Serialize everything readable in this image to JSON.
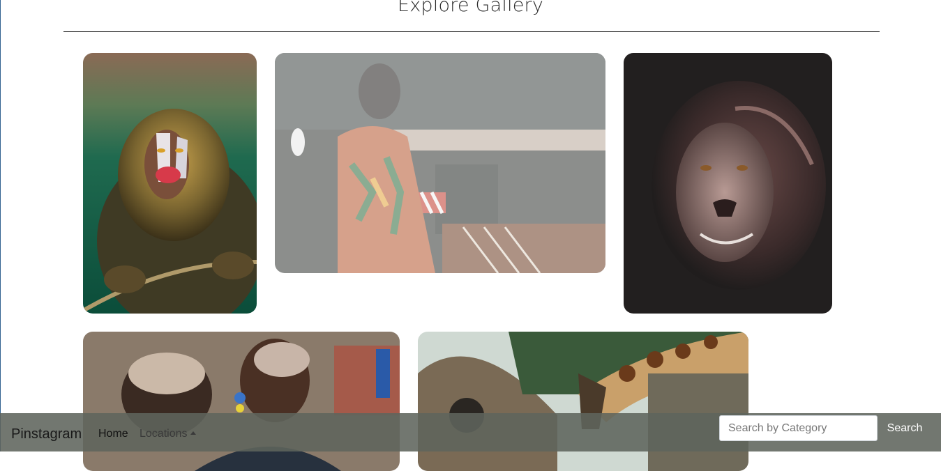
{
  "page": {
    "title": "Explore Gallery"
  },
  "gallery": {
    "images": [
      {
        "subject": "mandrill baboon holding rope"
      },
      {
        "subject": "musician playing marimba"
      },
      {
        "subject": "lion portrait"
      },
      {
        "subject": "two maasai women"
      },
      {
        "subject": "giraffe near huts"
      }
    ]
  },
  "navbar": {
    "brand": "Pinstagram",
    "links": [
      {
        "label": "Home"
      },
      {
        "label": "Locations"
      }
    ],
    "search": {
      "placeholder": "Search by Category",
      "button_label": "Search"
    }
  },
  "colors": {
    "navbar_bg": "#5f645c",
    "search_button_text": "#ffffff"
  }
}
